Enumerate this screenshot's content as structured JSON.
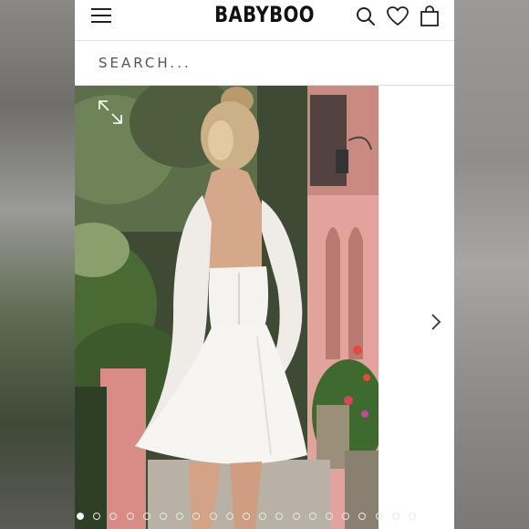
{
  "header": {
    "brand": "BABYBOO",
    "menu_icon": "hamburger-menu-icon",
    "search_icon": "search-icon",
    "wishlist_icon": "heart-icon",
    "cart_icon": "shopping-bag-icon"
  },
  "search": {
    "placeholder": "SEARCH..."
  },
  "gallery": {
    "expand_icon": "expand-arrows-icon",
    "next_icon": "chevron-right-icon",
    "image_count": 21,
    "active_index": 0
  },
  "colors": {
    "accent": "#111111",
    "background": "#ffffff",
    "dress": "#f4f2ef",
    "wall": "#e7a9a0"
  }
}
